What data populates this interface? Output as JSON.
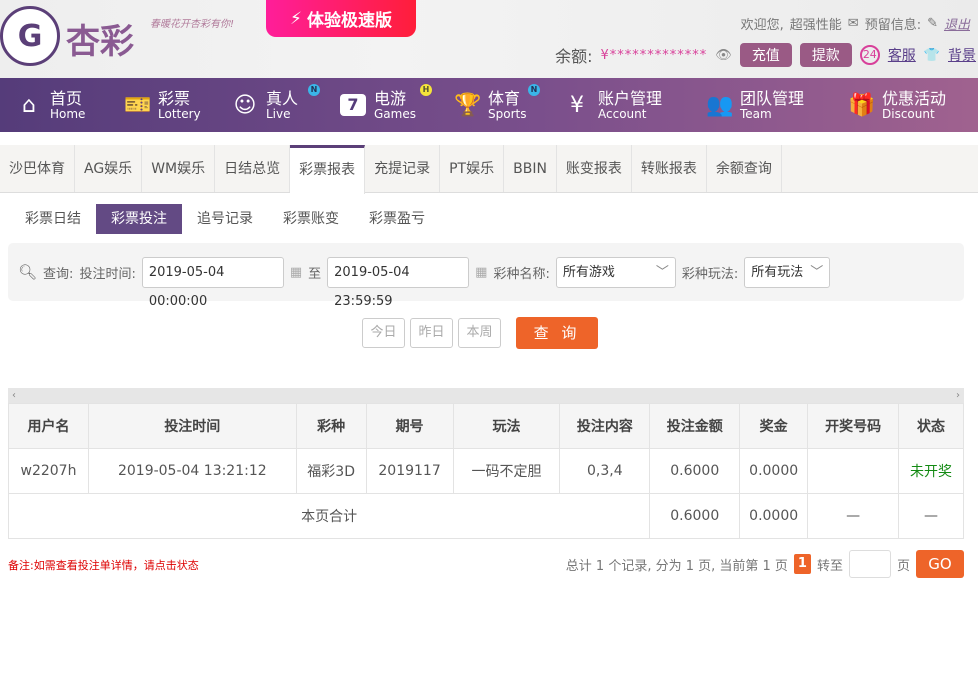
{
  "header": {
    "logo_text": "杏彩",
    "slogan": "春暖花开杏彩有你!",
    "speed_label": "体验极速版",
    "welcome": "欢迎您,",
    "username": "超强性能",
    "message_label": "预留信息:",
    "logout": "退出",
    "balance_label": "余额:",
    "balance_currency": "¥",
    "balance_masked": "*************",
    "deposit": "充值",
    "withdraw": "提款",
    "service": "客服",
    "background": "背景"
  },
  "nav": [
    {
      "cn": "首页",
      "en": "Home"
    },
    {
      "cn": "彩票",
      "en": "Lottery"
    },
    {
      "cn": "真人",
      "en": "Live",
      "badge": "N"
    },
    {
      "cn": "电游",
      "en": "Games",
      "badge": "H"
    },
    {
      "cn": "体育",
      "en": "Sports",
      "badge": "N"
    },
    {
      "cn": "账户管理",
      "en": "Account"
    },
    {
      "cn": "团队管理",
      "en": "Team"
    },
    {
      "cn": "优惠活动",
      "en": "Discount"
    }
  ],
  "tabs": [
    "沙巴体育",
    "AG娱乐",
    "WM娱乐",
    "日结总览",
    "彩票报表",
    "充提记录",
    "PT娱乐",
    "BBIN",
    "账变报表",
    "转账报表",
    "余额查询"
  ],
  "subtabs": [
    "彩票日结",
    "彩票投注",
    "追号记录",
    "彩票账变",
    "彩票盈亏"
  ],
  "filter": {
    "query": "查询:",
    "time_label": "投注时间:",
    "start": "2019-05-04 00:00:00",
    "to": "至",
    "end": "2019-05-04 23:59:59",
    "game_label": "彩种名称:",
    "game_value": "所有游戏",
    "play_label": "彩种玩法:",
    "play_value": "所有玩法"
  },
  "buttons": {
    "today": "今日",
    "yesterday": "昨日",
    "week": "本周",
    "search": "查 询"
  },
  "table": {
    "headers": [
      "用户名",
      "投注时间",
      "彩种",
      "期号",
      "玩法",
      "投注内容",
      "投注金额",
      "奖金",
      "开奖号码",
      "状态"
    ],
    "row": [
      "w2207h",
      "2019-05-04 13:21:12",
      "福彩3D",
      "2019117",
      "一码不定胆",
      "0,3,4",
      "0.6000",
      "0.0000",
      "",
      "未开奖"
    ],
    "total": {
      "label": "本页合计",
      "amount": "0.6000",
      "bonus": "0.0000",
      "number": "—",
      "status": "—"
    }
  },
  "note": "备注:如需查看投注单详情，请点击状态",
  "pager": {
    "summary": "总计 1 个记录, 分为 1 页, 当前第 1 页",
    "current": "1",
    "goto": "转至",
    "page": "页",
    "go": "GO"
  },
  "colors": {
    "purple": "#5b3f78",
    "orange": "#ee6429",
    "green": "#138a13"
  }
}
